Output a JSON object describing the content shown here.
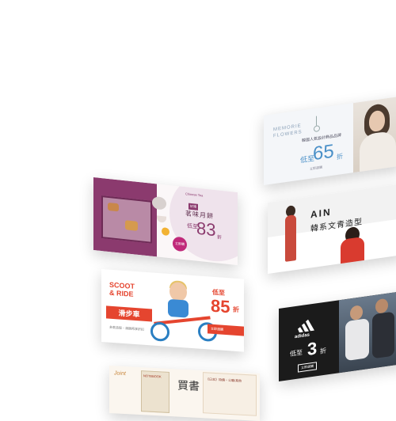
{
  "banners": {
    "jewelry": {
      "brand_line1": "MEMORIE",
      "brand_line2": "FLOWERS",
      "subtitle": "韓國人氣設計飾品品牌",
      "prefix": "低至",
      "discount": "65",
      "suffix": "折",
      "fine_print": "立即選購"
    },
    "mooncake": {
      "pill": "Chinese Tea",
      "tag": "好禮",
      "title": "茗味月餅",
      "prefix": "低至",
      "discount": "83",
      "suffix": "折",
      "badge": "立即購"
    },
    "ain": {
      "logo": "AIN",
      "subtitle": "韓系文青造型"
    },
    "scooter": {
      "title_line1": "SCOOT",
      "title_line2": "& RIDE",
      "category": "滑步車",
      "fine_print": "多款造型・滿額再享折扣",
      "prefix": "低至",
      "discount": "85",
      "suffix": "折",
      "cta": "立即選購"
    },
    "adidas": {
      "logo_text": "adidas",
      "prefix": "低至",
      "discount": "3",
      "suffix": "折",
      "cta": "立即選購"
    },
    "books": {
      "left_title": "Joint",
      "cover_text": "NOTEBOOK",
      "center_title": "買書",
      "right_text": "《日本》特價・公職/其他"
    }
  },
  "colors": {
    "jewel_accent": "#4a90c8",
    "moon_accent": "#8b3a6e",
    "scoot_accent": "#e5452f",
    "adidas_bg": "#1b1b1b"
  }
}
